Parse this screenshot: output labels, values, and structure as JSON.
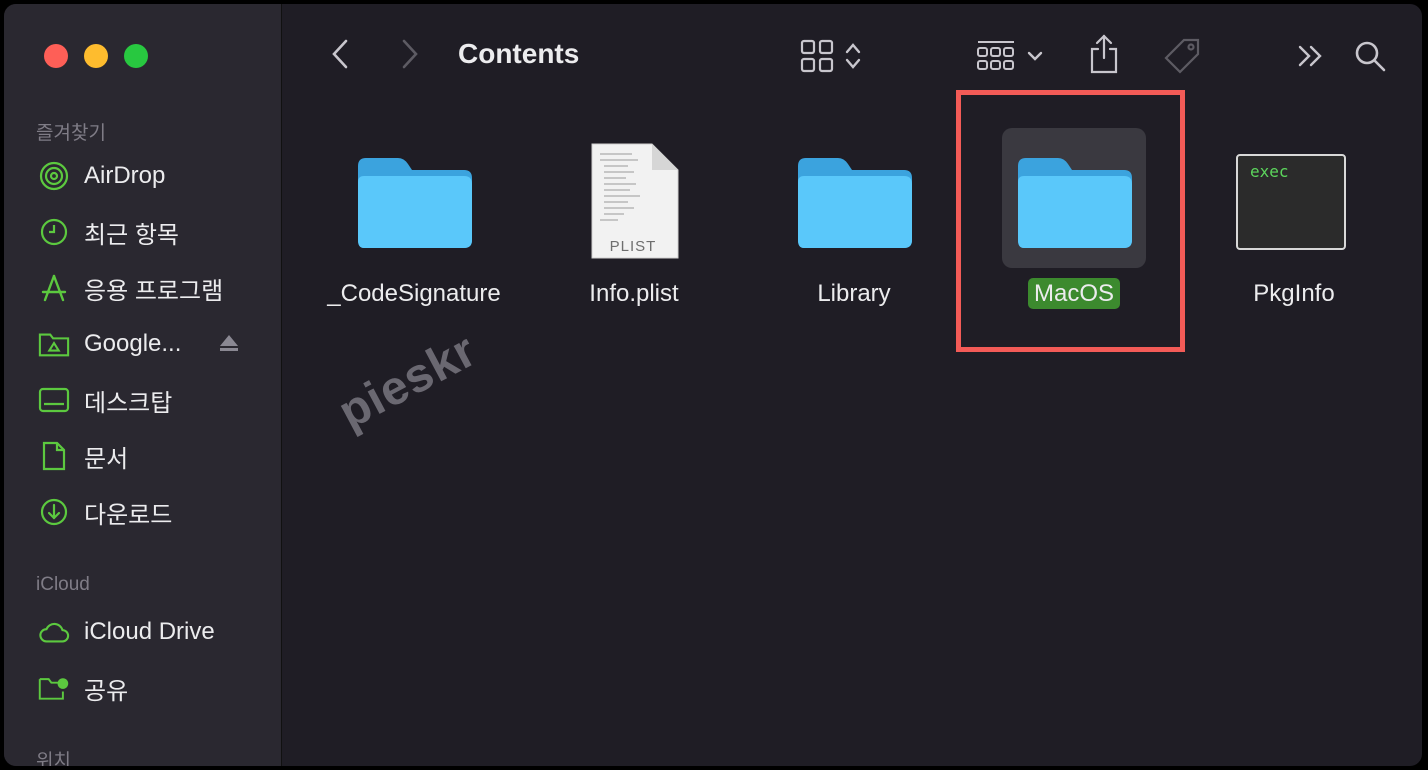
{
  "sidebar": {
    "favorites_label": "즐겨찾기",
    "icloud_label": "iCloud",
    "locations_label": "위치",
    "favorites": [
      {
        "label": "AirDrop",
        "icon": "airdrop-icon"
      },
      {
        "label": "최근 항목",
        "icon": "clock-icon"
      },
      {
        "label": "응용 프로그램",
        "icon": "applications-icon"
      },
      {
        "label": "Google...",
        "icon": "google-drive-folder-icon",
        "ejectable": true
      },
      {
        "label": "데스크탑",
        "icon": "desktop-icon"
      },
      {
        "label": "문서",
        "icon": "document-icon"
      },
      {
        "label": "다운로드",
        "icon": "download-icon"
      }
    ],
    "icloud": [
      {
        "label": "iCloud Drive",
        "icon": "cloud-icon"
      },
      {
        "label": "공유",
        "icon": "shared-folder-icon"
      }
    ]
  },
  "toolbar": {
    "title": "Contents"
  },
  "files": [
    {
      "name": "_CodeSignature",
      "type": "folder"
    },
    {
      "name": "Info.plist",
      "type": "plist",
      "badge": "PLIST"
    },
    {
      "name": "Library",
      "type": "folder"
    },
    {
      "name": "MacOS",
      "type": "folder",
      "selected": true
    },
    {
      "name": "PkgInfo",
      "type": "exec",
      "badge": "exec"
    }
  ],
  "watermark": "pieskr",
  "colors": {
    "accent_green": "#3c8a2e",
    "sidebar_icon_green": "#5cc93f",
    "folder_blue": "#5ac8fa",
    "highlight_red": "#f35b57"
  }
}
